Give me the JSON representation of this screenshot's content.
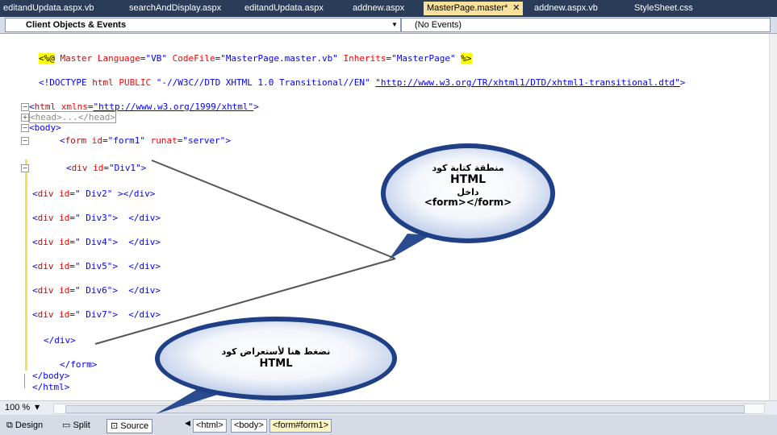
{
  "tabs": [
    {
      "label": "editandUpdata.aspx.vb",
      "active": false
    },
    {
      "label": "searchAndDisplay.aspx",
      "active": false
    },
    {
      "label": "editandUpdata.aspx",
      "active": false
    },
    {
      "label": "addnew.aspx",
      "active": false
    },
    {
      "label": "MasterPage.master*",
      "active": true,
      "close": "✕"
    },
    {
      "label": "addnew.aspx.vb",
      "active": false
    },
    {
      "label": "StyleSheet.css",
      "active": false
    }
  ],
  "navbar": {
    "left_value": "Client Objects & Events",
    "right_value": "(No Events)"
  },
  "code": {
    "l1_open": "<%@",
    "l1_mid": " Master ",
    "l1_attr1": "Language",
    "l1_eq1": "=",
    "l1_val1": "\"VB\"",
    "l1_attr2": " CodeFile",
    "l1_eq2": "=",
    "l1_val2": "\"MasterPage.master.vb\"",
    "l1_attr3": " Inherits",
    "l1_eq3": "=",
    "l1_val3": "\"MasterPage\"",
    "l1_close": "%>",
    "doctype_a": "<!DOCTYPE ",
    "doctype_b": "html",
    "doctype_c": " PUBLIC ",
    "doctype_d": "\"-//W3C//DTD XHTML 1.0 Transitional//EN\"",
    "doctype_e": "\"http://www.w3.org/TR/xhtml1/DTD/xhtml1-transitional.dtd\"",
    "doctype_f": ">",
    "html_open_a": "<",
    "html_open_b": "html",
    "html_open_c": " xmlns",
    "html_open_d": "=",
    "html_open_e": "\"http://www.w3.org/1999/xhtml\"",
    "html_open_f": ">",
    "head_collapsed": "<head>...</head>",
    "body_open": "<body>",
    "form_a": "<",
    "form_b": "form",
    "form_c": " id",
    "form_d": "=",
    "form_e": "\"form1\"",
    "form_f": " runat",
    "form_g": "=",
    "form_h": "\"server\"",
    "form_i": ">",
    "div1_a": "<",
    "div1_b": "div",
    "div1_c": " id",
    "div1_d": "=",
    "div1_e": "\"Div1\"",
    "div1_f": ">",
    "divs": [
      {
        "name": "div",
        "attr": " id",
        "val": "\" Div2\"",
        "gap": " ",
        "close": "></div>"
      },
      {
        "name": "div",
        "attr": " id",
        "val": "\" Div3\"",
        "gap": ">  ",
        "close": "</div>"
      },
      {
        "name": "div",
        "attr": " id",
        "val": "\" Div4\"",
        "gap": ">  ",
        "close": "</div>"
      },
      {
        "name": "div",
        "attr": " id",
        "val": "\" Div5\"",
        "gap": ">  ",
        "close": "</div>"
      },
      {
        "name": "div",
        "attr": " id",
        "val": "\" Div6\"",
        "gap": ">  ",
        "close": "</div>"
      },
      {
        "name": "div",
        "attr": " id",
        "val": "\" Div7\"",
        "gap": ">  ",
        "close": "</div>"
      }
    ],
    "div_close": "</div>",
    "form_close": "</form>",
    "body_close": "</body>",
    "html_close": "</html>"
  },
  "callouts": {
    "top": {
      "line1": "منطقة كتابة كود",
      "line2": "HTML",
      "line3": "داخل",
      "line4": "<form></form>"
    },
    "bottom": {
      "line1": "نضغط هنا لأستعراض كود",
      "line2": "HTML"
    }
  },
  "statusbar": {
    "zoom": "100 %",
    "design_label": "Design",
    "split_label": "Split",
    "source_label": "Source",
    "crumbs": [
      "<html>",
      "<body>",
      "<form#form1>"
    ]
  },
  "icons": {
    "design": "design-view-icon",
    "split": "split-view-icon",
    "source": "source-view-icon"
  }
}
